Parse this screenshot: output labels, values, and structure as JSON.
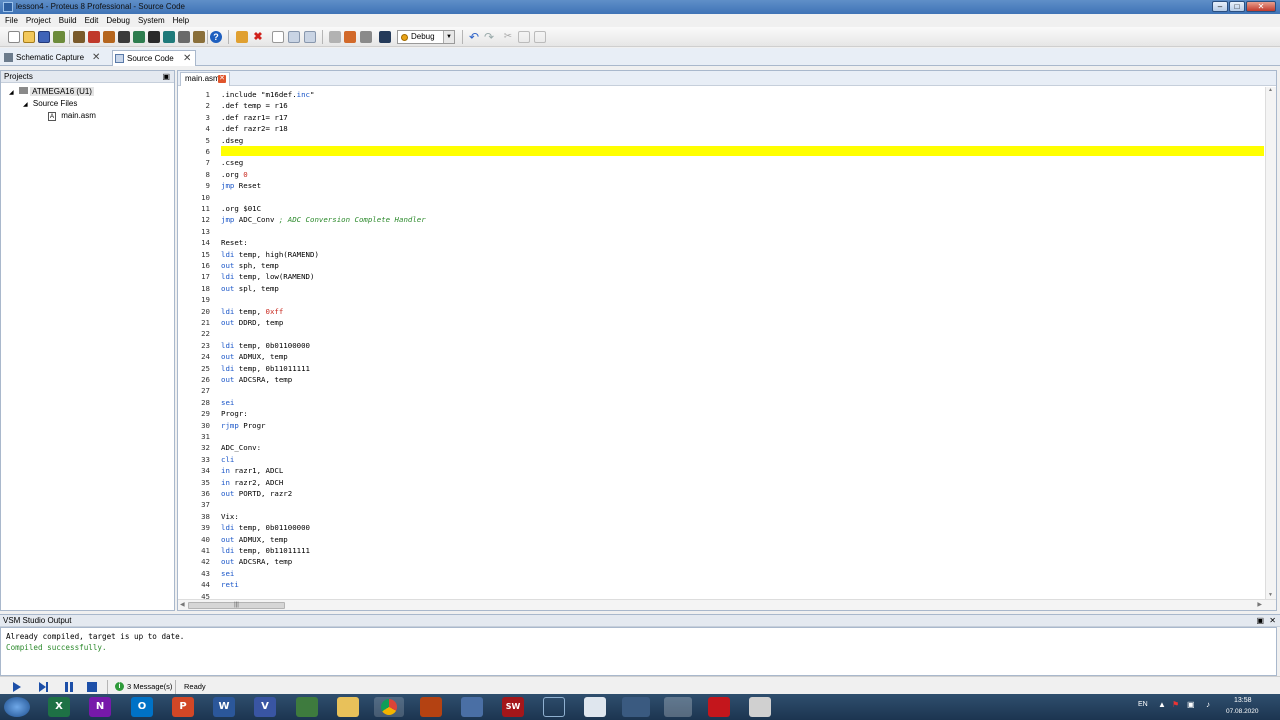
{
  "window": {
    "title": "lesson4 - Proteus 8 Professional - Source Code"
  },
  "menu": [
    "File",
    "Project",
    "Build",
    "Edit",
    "Debug",
    "System",
    "Help"
  ],
  "toolbar": {
    "config_value": "Debug"
  },
  "doc_tabs": [
    {
      "label": "Schematic Capture"
    },
    {
      "label": "Source Code"
    }
  ],
  "projects": {
    "header": "Projects",
    "root": "ATMEGA16 (U1)",
    "folder": "Source Files",
    "file": "main.asm"
  },
  "editor": {
    "tab": "main.asm",
    "highlighted_line": 6,
    "lines": [
      ".include \"m16def.inc\"",
      ".def temp = r16",
      ".def razr1= r17",
      ".def razr2= r18",
      ".dseg",
      "",
      ".cseg",
      ".org 0",
      "jmp Reset",
      "",
      ".org $01C",
      "jmp ADC_Conv ; ADC Conversion Complete Handler",
      "",
      "Reset:",
      "ldi temp, high(RAMEND)",
      "out sph, temp",
      "ldi temp, low(RAMEND)",
      "out spl, temp",
      "",
      "ldi temp, 0xff",
      "out DDRD, temp",
      "",
      "ldi temp, 0b01100000",
      "out ADMUX, temp",
      "ldi temp, 0b11011111",
      "out ADCSRA, temp",
      "",
      "sei",
      "Progr:",
      "rjmp Progr",
      "",
      "ADC_Conv:",
      "cli",
      "in razr1, ADCL",
      "in razr2, ADCH",
      "out PORTD, razr2",
      "",
      "Vix:",
      "ldi temp, 0b01100000",
      "out ADMUX, temp",
      "ldi temp, 0b11011111",
      "out ADCSRA, temp",
      "sei",
      "reti",
      ""
    ]
  },
  "output": {
    "header": "VSM Studio Output",
    "lines": [
      {
        "text": "Already compiled, target is up to date.",
        "color": "#000000"
      },
      {
        "text": "Compiled successfully.",
        "color": "#2c8a2c"
      }
    ]
  },
  "statusbar": {
    "messages": "3 Message(s)",
    "state": "Ready"
  },
  "taskbar": {
    "language": "EN",
    "time": "13:58",
    "date": "07.08.2020"
  },
  "colors": {
    "keyword": "#1a56c8",
    "comment": "#2c8a2c",
    "number": "#c8281e",
    "highlight": "#ffff00"
  }
}
